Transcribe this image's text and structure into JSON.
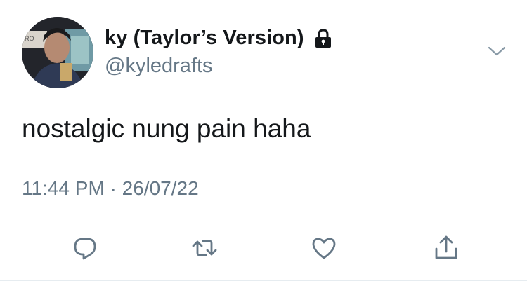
{
  "author": {
    "display_name": "ky (Taylor’s Version)",
    "handle": "@kyledrafts",
    "protected_icon": "lock-icon",
    "avatar_icon": "profile-photo"
  },
  "tweet": {
    "text": "nostalgic nung pain haha",
    "time": "11:44 PM",
    "separator": "·",
    "date": "26/07/22"
  },
  "menu": {
    "icon": "chevron-down-icon"
  },
  "actions": [
    {
      "name": "reply",
      "icon": "reply-icon"
    },
    {
      "name": "retweet",
      "icon": "retweet-icon"
    },
    {
      "name": "like",
      "icon": "heart-icon"
    },
    {
      "name": "share",
      "icon": "share-icon"
    }
  ],
  "colors": {
    "text_primary": "#14171a",
    "text_secondary": "#657786",
    "icon": "#657786",
    "divider": "#e1e8ed"
  }
}
